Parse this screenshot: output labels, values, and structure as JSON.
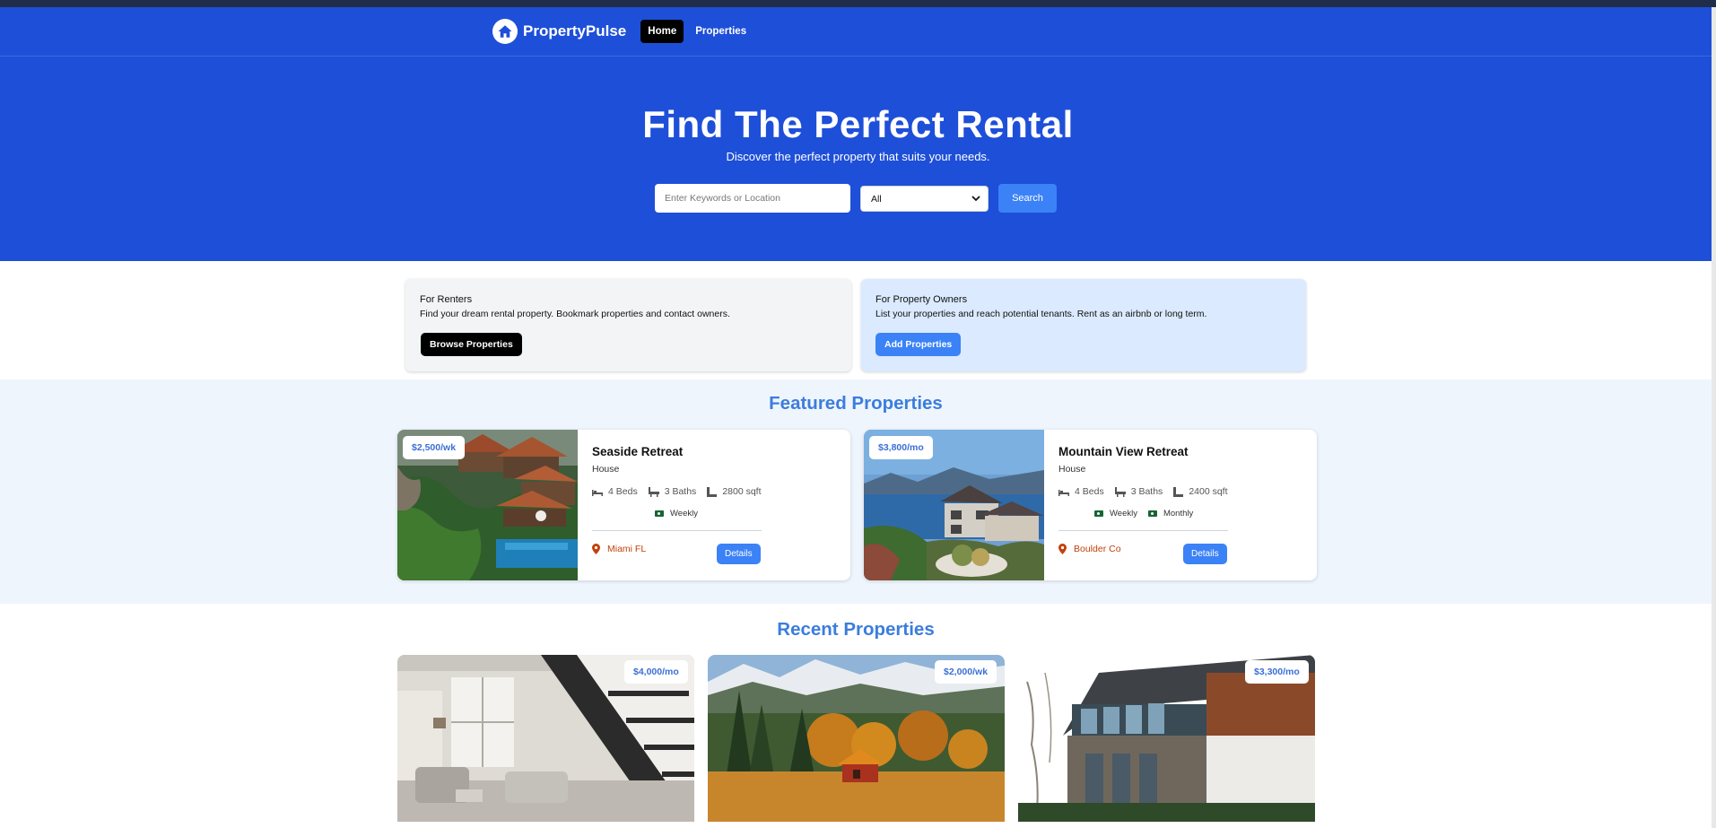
{
  "nav": {
    "brand": "PropertyPulse",
    "links": [
      {
        "label": "Home",
        "active": true
      },
      {
        "label": "Properties",
        "active": false
      }
    ]
  },
  "hero": {
    "title": "Find The Perfect Rental",
    "subtitle": "Discover the perfect property that suits your needs.",
    "search_placeholder": "Enter Keywords or Location",
    "type_selected": "All",
    "search_button": "Search"
  },
  "info": {
    "renters": {
      "title": "For Renters",
      "text": "Find your dream rental property. Bookmark properties and contact owners.",
      "button": "Browse Properties"
    },
    "owners": {
      "title": "For Property Owners",
      "text": "List your properties and reach potential tenants. Rent as an airbnb or long term.",
      "button": "Add Properties"
    }
  },
  "featured": {
    "title": "Featured Properties",
    "cards": [
      {
        "price": "$2,500/wk",
        "name": "Seaside Retreat",
        "type": "House",
        "beds": "4 Beds",
        "baths": "3 Baths",
        "sqft": "2800 sqft",
        "rates": [
          "Weekly"
        ],
        "location": "Miami FL",
        "details": "Details"
      },
      {
        "price": "$3,800/mo",
        "name": "Mountain View Retreat",
        "type": "House",
        "beds": "4 Beds",
        "baths": "3 Baths",
        "sqft": "2400 sqft",
        "rates": [
          "Weekly",
          "Monthly"
        ],
        "location": "Boulder Co",
        "details": "Details"
      }
    ]
  },
  "recent": {
    "title": "Recent Properties",
    "cards": [
      {
        "price": "$4,000/mo"
      },
      {
        "price": "$2,000/wk"
      },
      {
        "price": "$3,300/mo"
      }
    ]
  },
  "colors": {
    "primary_blue": "#1e4fd8",
    "accent_blue": "#3b82f6",
    "heading_blue": "#3b7ddd",
    "location_orange": "#c2410c",
    "rate_green": "#166534"
  },
  "icons": [
    "home-logo-icon",
    "bed-icon",
    "bath-icon",
    "ruler-icon",
    "money-icon",
    "map-pin-icon"
  ]
}
